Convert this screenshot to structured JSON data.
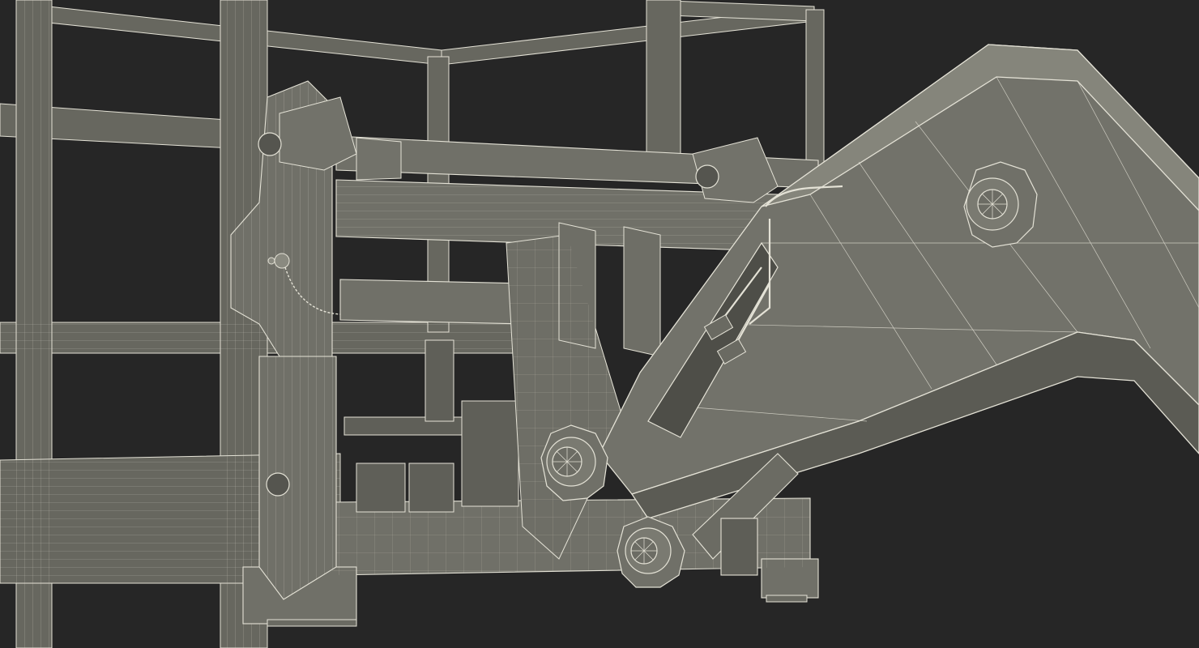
{
  "render": {
    "subject": "",
    "style": "",
    "colors": {
      "background": "#262626",
      "surface": "#6a6a62",
      "surface_light": "#7a7a71",
      "surface_dark": "#4e4e48",
      "wire": "#e4e2d6"
    }
  }
}
